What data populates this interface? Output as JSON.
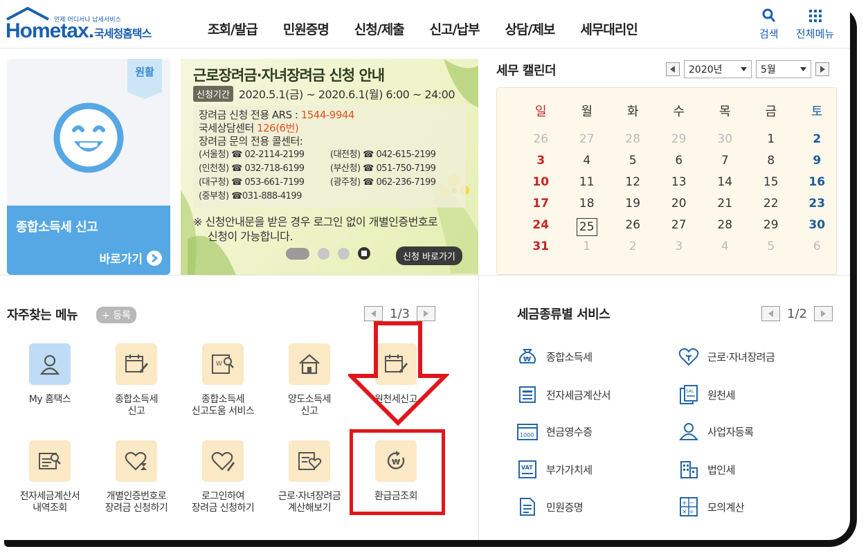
{
  "header": {
    "logo_tagline": "언제 어디서나 납세서비스",
    "logo_word": "Hometax.",
    "logo_kr": "국세청홈택스",
    "nav": [
      "조회/발급",
      "민원증명",
      "신청/제출",
      "신고/납부",
      "상담/제보",
      "세무대리인"
    ],
    "search_label": "검색",
    "allmenu_label": "전체메뉴"
  },
  "promo": {
    "flag": "원활",
    "title": "종합소득세 신고",
    "go_label": "바로가기"
  },
  "banner": {
    "title": "근로장려금·자녀장려금 신청 안내",
    "period_tag": "신청기간",
    "period_text": "2020.5.1(금) ~ 2020.6.1(월) 6:00 ~ 24:00",
    "ars_label": "장려금 신청 전용 ARS : ",
    "ars_number": "1544-9944",
    "center_label": "국세상담센터 ",
    "center_number": "126(6번)",
    "contact_heading": "장려금 문의 전용 콜센터:",
    "contacts": [
      "(서울청) ☎ 02-2114-2199",
      "(대전청) ☎ 042-615-2199",
      "(인천청) ☎ 032-718-6199",
      "(부산청) ☎ 051-750-7199",
      "(대구청) ☎ 053-661-7199",
      "(광주청) ☎ 062-236-7199",
      "(중부청) ☎031-888-4199"
    ],
    "note_line1": "※ 신청안내문을 받은 경우 로그인 없이 개별인증번호로",
    "note_line2": "신청이 가능합니다.",
    "apply_btn": "신청 바로가기"
  },
  "calendar": {
    "title": "세무 캘린더",
    "year": "2020년",
    "month": "5월",
    "weekdays": [
      "일",
      "월",
      "화",
      "수",
      "목",
      "금",
      "토"
    ],
    "weeks": [
      [
        "26",
        "27",
        "28",
        "29",
        "30",
        "1",
        "2"
      ],
      [
        "3",
        "4",
        "5",
        "6",
        "7",
        "8",
        "9"
      ],
      [
        "10",
        "11",
        "12",
        "13",
        "14",
        "15",
        "16"
      ],
      [
        "17",
        "18",
        "19",
        "20",
        "21",
        "22",
        "23"
      ],
      [
        "24",
        "25",
        "26",
        "27",
        "28",
        "29",
        "30"
      ],
      [
        "31",
        "1",
        "2",
        "3",
        "4",
        "5",
        "6"
      ]
    ],
    "today": "25"
  },
  "frequent": {
    "title": "자주찾는 메뉴",
    "register_btn": "+ 등록",
    "page": "1/3",
    "items": [
      {
        "line1": "My 홈택스",
        "line2": "",
        "icon": "user-icon"
      },
      {
        "line1": "종합소득세",
        "line2": "신고",
        "icon": "calendar-pen-icon"
      },
      {
        "line1": "종합소득세",
        "line2": "신고도움 서비스",
        "icon": "document-search-icon"
      },
      {
        "line1": "양도소득세",
        "line2": "신고",
        "icon": "house-icon"
      },
      {
        "line1": "원천세신고",
        "line2": "",
        "icon": "calendar-pen-icon"
      },
      {
        "line1": "전자세금계산서",
        "line2": "내역조회",
        "icon": "invoice-search-icon"
      },
      {
        "line1": "개별인증번호로",
        "line2": "장려금 신청하기",
        "icon": "heart-hourglass-icon"
      },
      {
        "line1": "로그인하여",
        "line2": "장려금 신청하기",
        "icon": "heart-pen-icon"
      },
      {
        "line1": "근로·자녀장려금",
        "line2": "계산해보기",
        "icon": "heart-calculator-icon"
      },
      {
        "line1": "환급금조회",
        "line2": "",
        "icon": "refund-won-icon"
      }
    ]
  },
  "services": {
    "title": "세금종류별 서비스",
    "page": "1/2",
    "items": [
      {
        "label": "종합소득세",
        "icon": "money-bag-icon"
      },
      {
        "label": "근로·자녀장려금",
        "icon": "heart-icon"
      },
      {
        "label": "전자세금계산서",
        "icon": "invoice-icon"
      },
      {
        "label": "원천세",
        "icon": "salary-document-icon"
      },
      {
        "label": "현금영수증",
        "icon": "receipt-1000-icon"
      },
      {
        "label": "사업자등록",
        "icon": "person-icon"
      },
      {
        "label": "부가가치세",
        "icon": "vat-icon"
      },
      {
        "label": "법인세",
        "icon": "building-icon"
      },
      {
        "label": "민원증명",
        "icon": "document-icon"
      },
      {
        "label": "모의계산",
        "icon": "calculator-icon"
      }
    ]
  },
  "colors": {
    "brand_blue": "#1a5fae",
    "promo_blue": "#55a8e4",
    "sunday_red": "#c82424",
    "saturday_blue": "#1c5d9c",
    "annotation_red": "#e0161b",
    "menu_icon_bg": "#fbe8c4"
  }
}
